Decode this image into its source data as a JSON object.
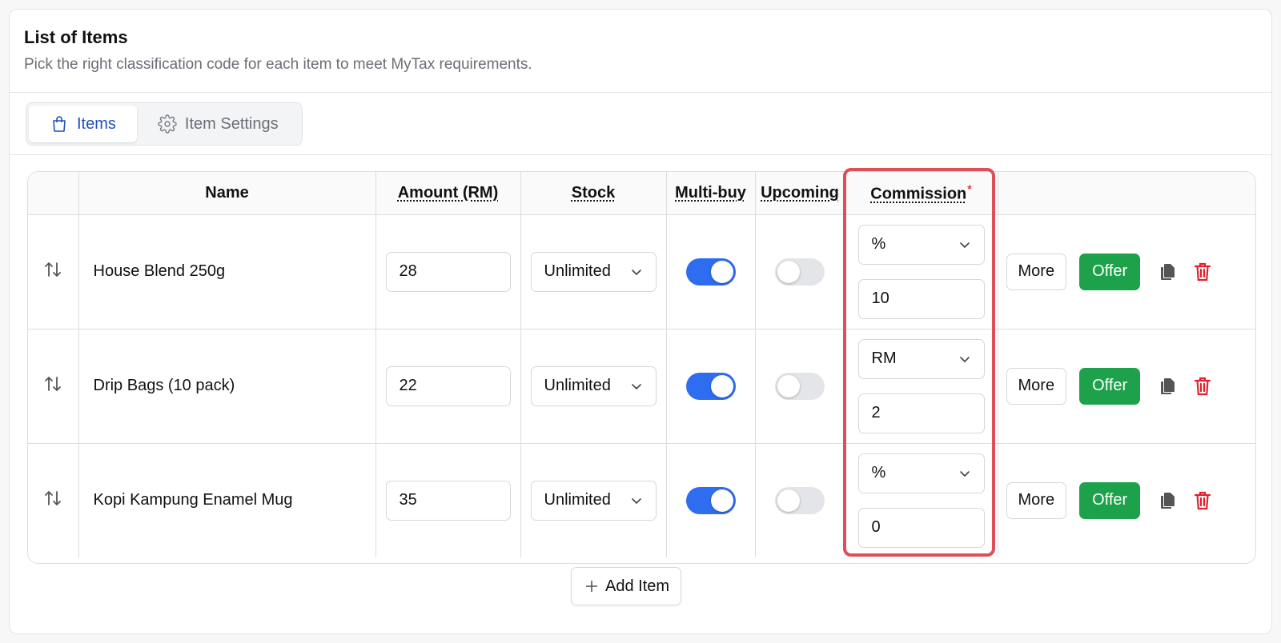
{
  "header": {
    "title": "List of Items",
    "subtitle": "Pick the right classification code for each item to meet MyTax requirements."
  },
  "tabs": [
    {
      "label": "Items",
      "icon": "shopping-bag-icon",
      "active": true
    },
    {
      "label": "Item Settings",
      "icon": "gear-icon",
      "active": false
    }
  ],
  "table": {
    "columns": {
      "name": "Name",
      "amount": "Amount (RM)",
      "stock": "Stock",
      "multibuy": "Multi-buy",
      "upcoming": "Upcoming",
      "commission": "Commission",
      "commission_required": "*"
    },
    "rows": [
      {
        "name": "House Blend 250g",
        "amount": "28",
        "stock": "Unlimited",
        "multibuy": true,
        "upcoming": false,
        "commission_type": "%",
        "commission_value": "10"
      },
      {
        "name": "Drip Bags (10 pack)",
        "amount": "22",
        "stock": "Unlimited",
        "multibuy": true,
        "upcoming": false,
        "commission_type": "RM",
        "commission_value": "2"
      },
      {
        "name": "Kopi Kampung Enamel Mug",
        "amount": "35",
        "stock": "Unlimited",
        "multibuy": true,
        "upcoming": false,
        "commission_type": "%",
        "commission_value": "0"
      }
    ]
  },
  "actions": {
    "more_label": "More",
    "offer_label": "Offer",
    "offer_color": "#1ea14b",
    "delete_color": "#e0212e"
  },
  "add_item_label": "Add Item",
  "colors": {
    "accent": "#1f4fbf",
    "toggle_on": "#2f6df0",
    "highlight": "#df4f5a"
  }
}
